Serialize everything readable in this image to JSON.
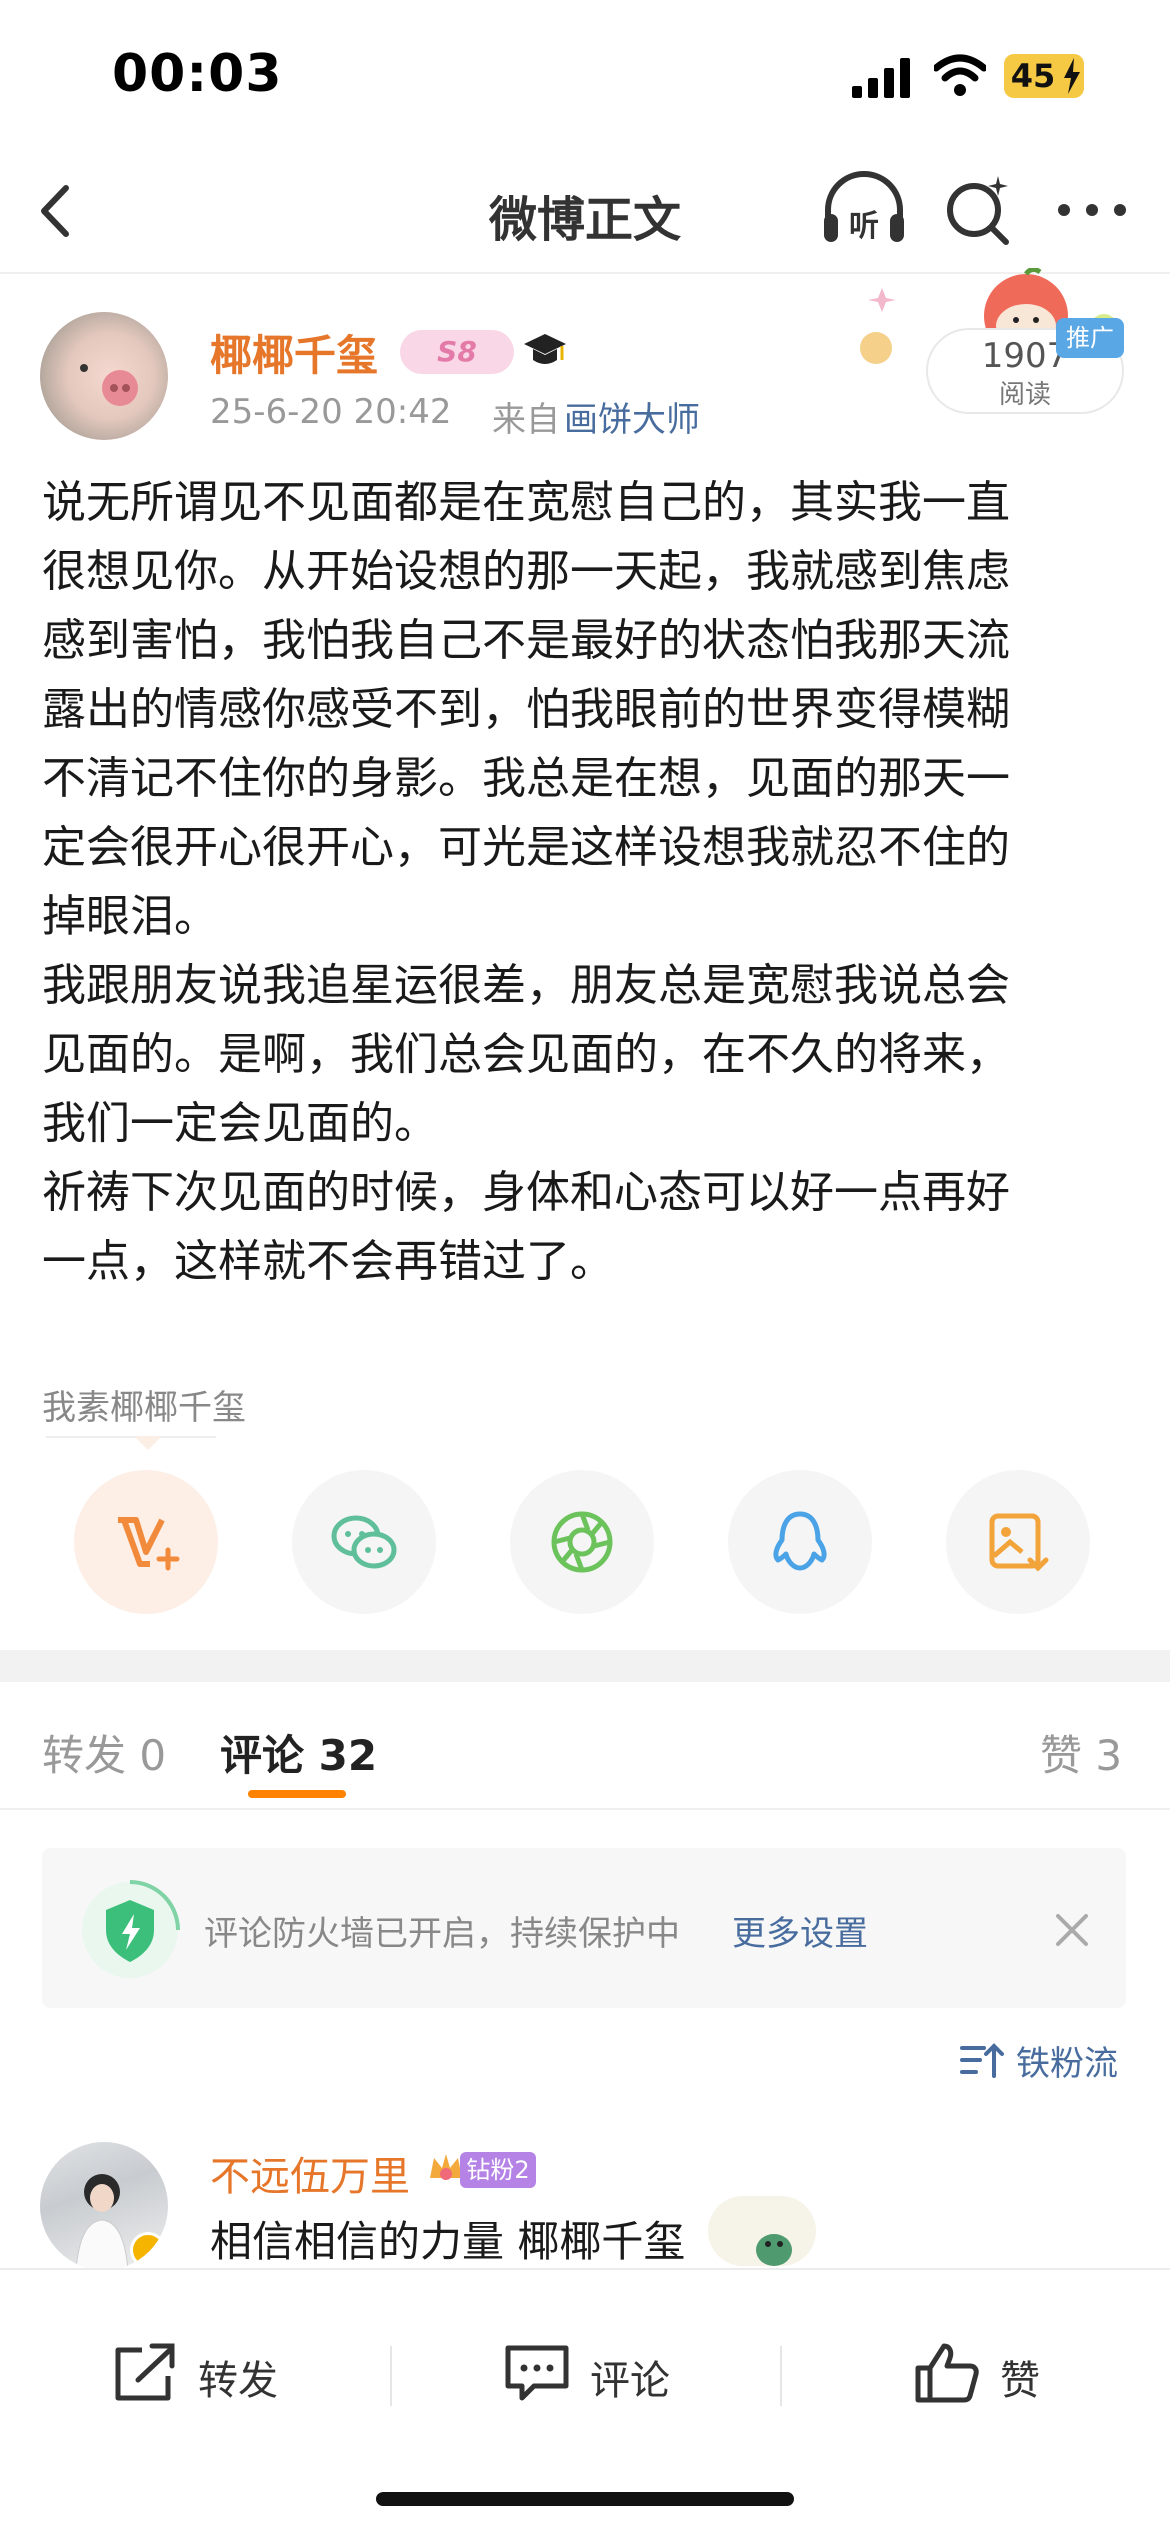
{
  "status_bar": {
    "time": "00:03",
    "battery": "45"
  },
  "nav": {
    "title": "微博正文",
    "listen_label": "听"
  },
  "author": {
    "name": "椰椰千玺",
    "level_badge": "S8",
    "time": "25-6-20 20:42",
    "source_prefix": "来自",
    "source": "画饼大师"
  },
  "ad": {
    "read_count": "1907",
    "read_label": "阅读",
    "promo_label": "推广"
  },
  "post": {
    "paragraphs": [
      "说无所谓见不见面都是在宽慰自己的，其实我一直\n很想见你。从开始设想的那一天起，我就感到焦虑\n感到害怕，我怕我自己不是最好的状态怕我那天流\n露出的情感你感受不到，怕我眼前的世界变得模糊\n不清记不住你的身影。我总是在想，见面的那天一\n定会很开心很开心，可光是这样设想我就忍不住的\n掉眼泪。",
      "我跟朋友说我追星运很差，朋友总是宽慰我说总会\n见面的。是啊，我们总会见面的，在不久的将来，\n我们一定会见面的。",
      "祈祷下次见面的时候，身体和心态可以好一点再好\n一点，这样就不会再错过了。"
    ],
    "topic_tag": "我素椰椰千玺"
  },
  "tabs": {
    "repost": "转发 0",
    "comments": "评论 32",
    "likes": "赞 3"
  },
  "firewall": {
    "text": "评论防火墙已开启，持续保护中",
    "link": "更多设置"
  },
  "sort": {
    "label": "铁粉流"
  },
  "comment": {
    "name": "不远伍万里",
    "fan_badge": "钻粉2",
    "text": "相信相信的力量 椰椰千玺"
  },
  "bottom_bar": {
    "repost": "转发",
    "comment": "评论",
    "like": "赞"
  },
  "colors": {
    "accent": "#ff8200",
    "name": "#e5762a",
    "link": "#486c9e"
  }
}
